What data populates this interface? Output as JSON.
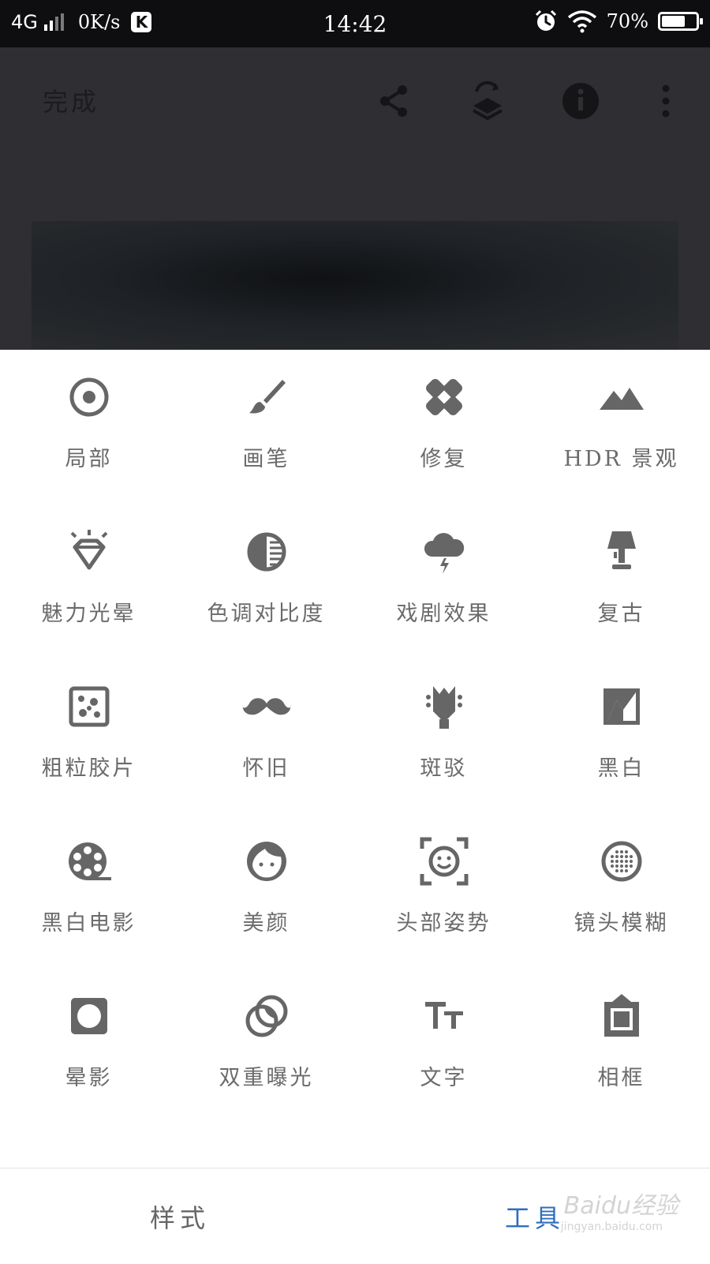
{
  "status_bar": {
    "network": "4G",
    "speed": "0K/s",
    "app_badge": "K",
    "time": "14:42",
    "battery_text": "70%",
    "battery_level": 0.7,
    "icons": [
      "signal-icon",
      "alarm-icon",
      "wifi-icon",
      "battery-icon"
    ]
  },
  "toolbar": {
    "done_label": "完成",
    "icons": [
      "share-icon",
      "layers-undo-icon",
      "info-icon",
      "more-vert-icon"
    ]
  },
  "tools": [
    {
      "label": "局部",
      "icon": "selective-target-icon"
    },
    {
      "label": "画笔",
      "icon": "brush-icon"
    },
    {
      "label": "修复",
      "icon": "healing-bandage-icon"
    },
    {
      "label": "HDR 景观",
      "icon": "mountains-icon"
    },
    {
      "label": "魅力光晕",
      "icon": "diamond-glow-icon"
    },
    {
      "label": "色调对比度",
      "icon": "tonal-contrast-icon"
    },
    {
      "label": "戏剧效果",
      "icon": "storm-cloud-icon"
    },
    {
      "label": "复古",
      "icon": "lamp-icon"
    },
    {
      "label": "粗粒胶片",
      "icon": "dice-grain-icon"
    },
    {
      "label": "怀旧",
      "icon": "mustache-icon"
    },
    {
      "label": "斑驳",
      "icon": "guitar-head-icon"
    },
    {
      "label": "黑白",
      "icon": "black-white-icon"
    },
    {
      "label": "黑白电影",
      "icon": "film-reel-icon"
    },
    {
      "label": "美颜",
      "icon": "face-icon"
    },
    {
      "label": "头部姿势",
      "icon": "face-frame-icon"
    },
    {
      "label": "镜头模糊",
      "icon": "lens-blur-icon"
    },
    {
      "label": "晕影",
      "icon": "vignette-icon"
    },
    {
      "label": "双重曝光",
      "icon": "double-exposure-icon"
    },
    {
      "label": "文字",
      "icon": "text-icon"
    },
    {
      "label": "相框",
      "icon": "frame-icon"
    }
  ],
  "bottom_nav": {
    "styles_label": "样式",
    "tools_label": "工具",
    "active": "工具",
    "active_color": "#2e6fbd"
  },
  "watermark": {
    "text": "Baidu经验",
    "sub": "jingyan.baidu.com"
  }
}
